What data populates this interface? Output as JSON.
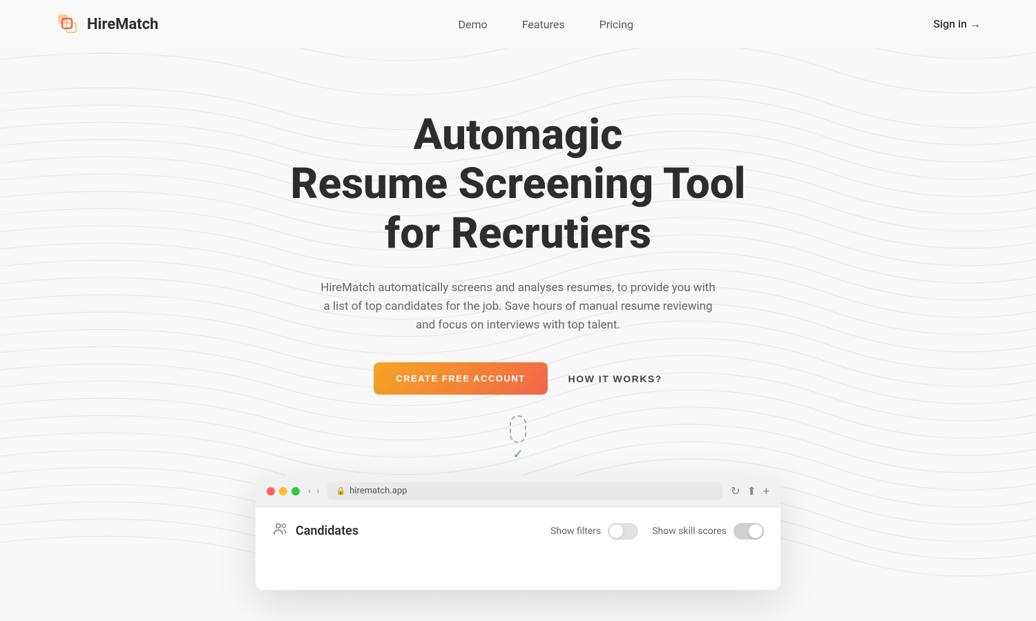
{
  "meta": {
    "title": "HireMatch - Automagic Resume Screening Tool"
  },
  "nav": {
    "logo_text": "HireMatch",
    "links": [
      {
        "label": "Demo",
        "id": "demo"
      },
      {
        "label": "Features",
        "id": "features"
      },
      {
        "label": "Pricing",
        "id": "pricing"
      }
    ],
    "signin_label": "Sign in →"
  },
  "hero": {
    "title_line1": "Automagic",
    "title_line2": "Resume Screening Tool",
    "title_line3": "for Recrutiers",
    "subtitle": "HireMatch automatically screens and analyses resumes, to provide you with a list of top candidates for the job. Save hours of manual resume reviewing and focus on interviews with top talent.",
    "cta_primary": "CREATE FREE ACCOUNT",
    "cta_secondary": "HOW IT WORKS?"
  },
  "browser": {
    "url": "hirematch.app",
    "candidates_label": "Candidates",
    "show_filters_label": "Show filters",
    "show_skill_scores_label": "Show skill scores"
  },
  "colors": {
    "brand_gradient_start": "#f5a623",
    "brand_gradient_end": "#f0654a",
    "accent_green": "#7cb8a0"
  }
}
